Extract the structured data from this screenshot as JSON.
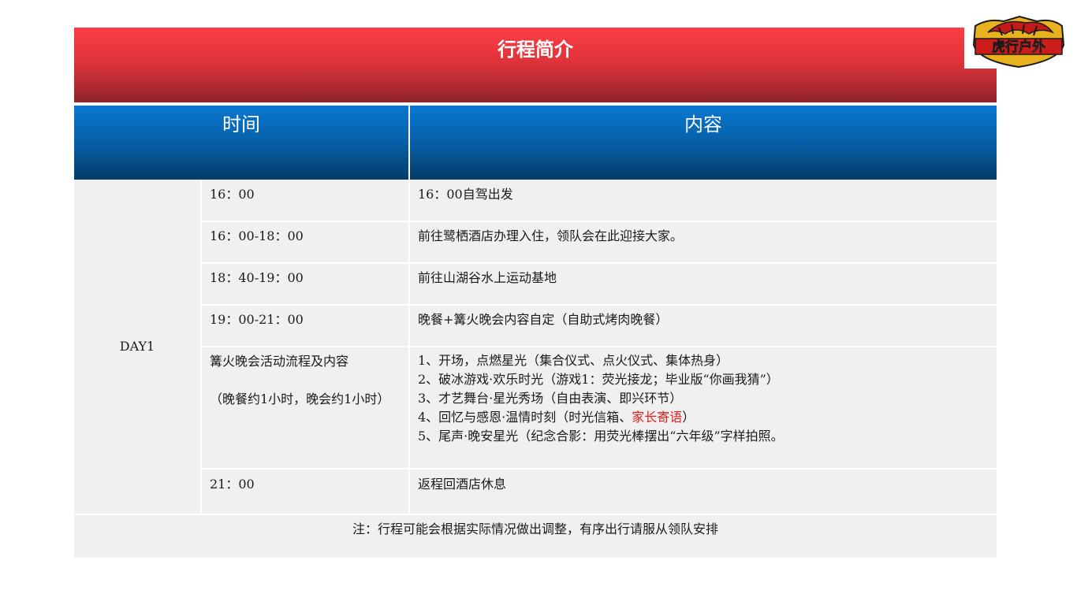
{
  "title": "行程简介",
  "logo": {
    "text": "虎行户外",
    "colors": {
      "shield": "#e8b21e",
      "band": "#cc1c1c",
      "outline": "#1a1a1a"
    }
  },
  "colors": {
    "title_red": "#fb3d44",
    "header_blue": "#0a78cf",
    "cell_bg": "#f0f0f0",
    "highlight": "#e02020"
  },
  "table": {
    "headers": {
      "time": "时间",
      "content": "内容"
    },
    "day_label": "DAY1",
    "rows": [
      {
        "time": "16：00",
        "content": "16：00自驾出发"
      },
      {
        "time": "16：00-18：00",
        "content": "前往鹭栖酒店办理入住，领队会在此迎接大家。"
      },
      {
        "time": "18：40-19：00",
        "content": "前往山湖谷水上运动基地"
      },
      {
        "time": "19：00-21：00",
        "content": "晚餐+篝火晚会内容自定（自助式烤肉晚餐）"
      },
      {
        "time": "篝火晚会活动流程及内容",
        "time_note": "（晚餐约1小时，晚会约1小时）",
        "items": [
          "1、开场，点燃星光（集合仪式、点火仪式、集体热身）",
          "2、破冰游戏·欢乐时光（游戏1：荧光接龙；毕业版“你画我猜”）",
          "3、才艺舞台·星光秀场（自由表演、即兴环节）",
          "5、尾声·晚安星光（纪念合影：用荧光棒摆出“六年级”字样拍照。"
        ],
        "item4_prefix": "4、回忆与感恩·温情时刻（时光信箱、",
        "item4_highlight": "家长寄语",
        "item4_suffix": "）"
      },
      {
        "time": "21：00",
        "content": "返程回酒店休息"
      }
    ],
    "footer": "注：行程可能会根据实际情况做出调整，有序出行请服从领队安排"
  }
}
